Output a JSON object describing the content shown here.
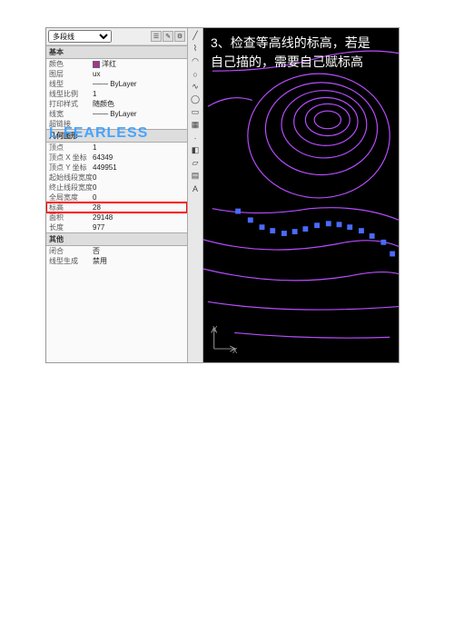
{
  "dropdown": {
    "selected": "多段线"
  },
  "sections": {
    "basic": {
      "title": "基本",
      "rows": [
        {
          "label": "颜色",
          "value": "洋红",
          "swatch": true
        },
        {
          "label": "图层",
          "value": "ux"
        },
        {
          "label": "线型",
          "value": "─── ByLayer"
        },
        {
          "label": "线型比例",
          "value": "1"
        },
        {
          "label": "打印样式",
          "value": "随颜色"
        },
        {
          "label": "线宽",
          "value": "─── ByLayer"
        },
        {
          "label": "超链接",
          "value": ""
        }
      ]
    },
    "geom": {
      "title": "几何图形",
      "rows": [
        {
          "label": "顶点",
          "value": "1"
        },
        {
          "label": "顶点 X 坐标",
          "value": "64349"
        },
        {
          "label": "顶点 Y 坐标",
          "value": "449951"
        },
        {
          "label": "起始线段宽度",
          "value": "0"
        },
        {
          "label": "终止线段宽度",
          "value": "0"
        },
        {
          "label": "全局宽度",
          "value": "0"
        },
        {
          "label": "标高",
          "value": "28",
          "highlight": true
        },
        {
          "label": "面积",
          "value": "29148"
        },
        {
          "label": "长度",
          "value": "977"
        }
      ]
    },
    "misc": {
      "title": "其他",
      "rows": [
        {
          "label": "闭合",
          "value": "否"
        },
        {
          "label": "线型生成",
          "value": "禁用"
        }
      ]
    }
  },
  "watermark": "FEARLESS",
  "annot": {
    "line1": "3、检查等高线的标高，若是",
    "line2": "自己描的，需要自己赋标高"
  },
  "axis": {
    "x": "X",
    "y": "Y"
  }
}
